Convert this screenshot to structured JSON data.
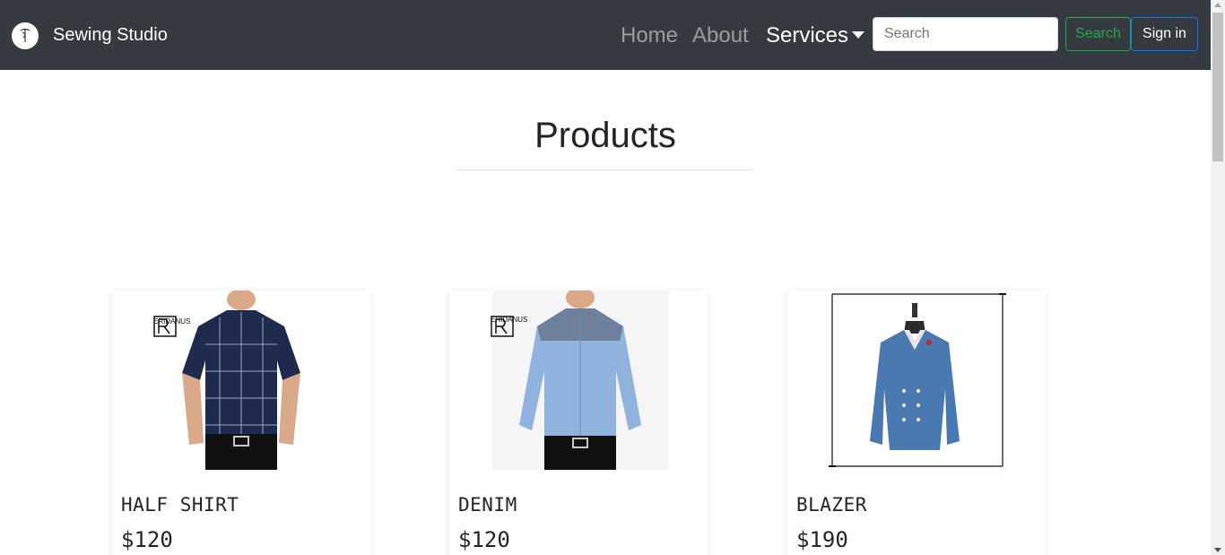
{
  "navbar": {
    "brand": "Sewing Studio",
    "links": {
      "home": "Home",
      "about": "About",
      "services": "Services"
    },
    "search_placeholder": "Search",
    "search_button": "Search",
    "signin_button": "Sign in"
  },
  "main": {
    "heading": "Products"
  },
  "products": [
    {
      "title": "HALF SHIRT",
      "price": "$120",
      "logo_text": "ERIDANUS"
    },
    {
      "title": "DENIM",
      "price": "$120",
      "logo_text": "ERIDANUS"
    },
    {
      "title": "BLAZER",
      "price": "$190"
    }
  ],
  "colors": {
    "navbar_bg": "#343a40",
    "search_green": "#28a745",
    "signin_blue": "#007bff",
    "half_shirt": "#1f2a4f",
    "denim_light": "#8fb3dc",
    "denim_yoke": "#6f7f9e",
    "blazer": "#4a78b0"
  },
  "icons": {
    "brand_logo": "needle-thread-icon",
    "dropdown": "caret-down-icon"
  }
}
